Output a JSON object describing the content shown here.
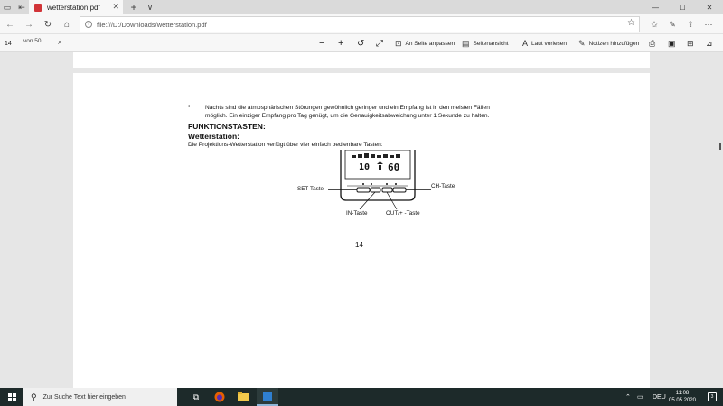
{
  "browser": {
    "tab": {
      "title": "wetterstation.pdf",
      "close_glyph": "✕"
    },
    "new_tab_glyph": "+",
    "tab_menu_glyph": "∨",
    "window_controls": {
      "minimize": "—",
      "maximize": "☐",
      "close": "✕"
    },
    "url": "file:///D:/Downloads/wetterstation.pdf",
    "icons": [
      "tab-actions-icon",
      "back-tabs-icon",
      "back-icon",
      "forward-icon",
      "refresh-icon",
      "home-icon",
      "info-icon",
      "favorite-star-icon",
      "favorites-list-icon",
      "reading-list-icon",
      "share-icon",
      "more-icon"
    ]
  },
  "pdf_toolbar": {
    "page_current": "14",
    "page_total": "von 50",
    "fit_page": "An Seite anpassen",
    "page_view": "Seitenansicht",
    "read_aloud": "Laut vorlesen",
    "add_notes": "Notizen hinzufügen"
  },
  "document": {
    "bullet_line1": "Nachts sind die atmosphärischen Störungen gewöhnlich geringer und ein Empfang ist in den meisten Fällen",
    "bullet_line2": "möglich. Ein einziger Empfang pro Tag genügt, um die Genauigkeitsabweichung unter 1 Sekunde zu halten.",
    "heading1": "FUNKTIONSTASTEN:",
    "heading2": "Wetterstation:",
    "description": "Die Projektions-Wetterstation verfügt über vier einfach bedienbare Tasten:",
    "diagram": {
      "display_left": "10",
      "display_right": "60",
      "label_set": "SET-Taste",
      "label_ch": "CH-Taste",
      "label_in": "IN-Taste",
      "label_out": "OUT/+ -Taste"
    },
    "page_number": "14"
  },
  "taskbar": {
    "search_placeholder": "Zur Suche Text hier eingeben",
    "language": "DEU",
    "time": "11:08",
    "date": "05.05.2020",
    "notification_count": "3"
  },
  "colors": {
    "pdf_accent": "#d13438",
    "taskbar_bg": "#1d2a2a",
    "active_app_indicator": "#8fb6d8"
  }
}
